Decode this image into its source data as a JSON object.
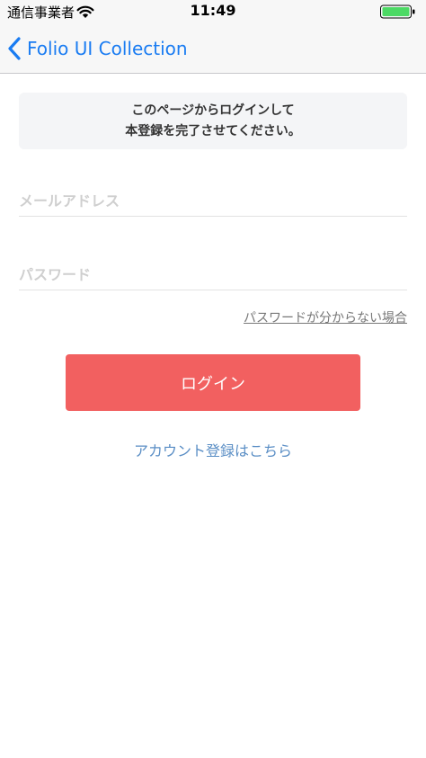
{
  "status_bar": {
    "carrier": "通信事業者",
    "time": "11:49",
    "battery_color": "#4cd964"
  },
  "nav": {
    "back_label": "Folio UI Collection",
    "accent_color": "#1a7cf2"
  },
  "message": {
    "line1": "このページからログインして",
    "line2": "本登録を完了させてください。"
  },
  "form": {
    "email_placeholder": "メールアドレス",
    "email_value": "",
    "password_placeholder": "パスワード",
    "password_value": "",
    "forgot_password": "パスワードが分からない場合",
    "login_button": "ログイン",
    "login_button_color": "#f26060",
    "register_link": "アカウント登録はこちら"
  },
  "icons": {
    "wifi": "wifi-icon",
    "battery": "battery-icon",
    "back": "chevron-left-icon"
  }
}
